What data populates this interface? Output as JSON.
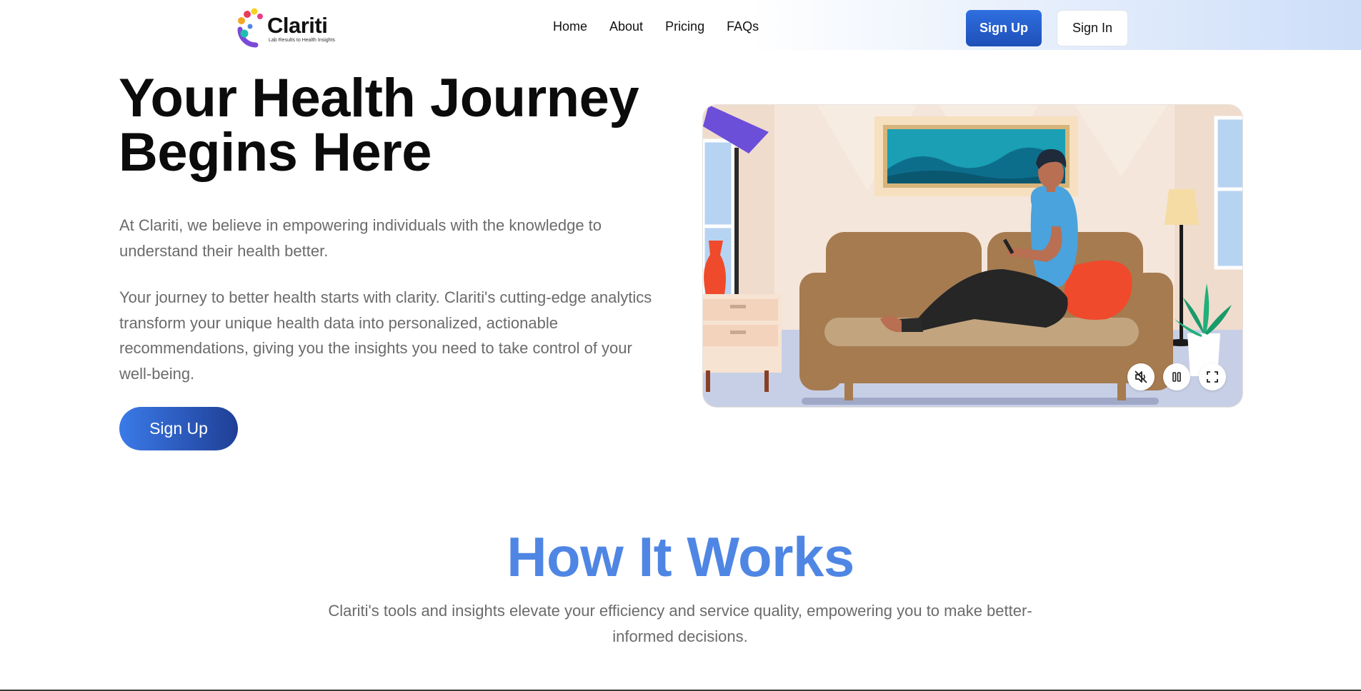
{
  "brand": {
    "name": "Clariti",
    "tagline": "Lab Results to Health Insights"
  },
  "nav": {
    "items": [
      {
        "label": "Home"
      },
      {
        "label": "About"
      },
      {
        "label": "Pricing"
      },
      {
        "label": "FAQs"
      }
    ]
  },
  "header": {
    "signup_label": "Sign Up",
    "signin_label": "Sign In"
  },
  "hero": {
    "title_line1": "Your Health Journey",
    "title_line2": "Begins Here",
    "paragraph1": "At Clariti, we believe in empowering individuals with the knowledge to understand their health better.",
    "paragraph2": "Your journey to better health starts with clarity. Clariti's cutting-edge analytics transform your unique health data into personalized, actionable recommendations, giving you the insights you need to take control of your well-being.",
    "cta_label": "Sign Up"
  },
  "video": {
    "controls": [
      {
        "name": "mute",
        "icon": "volume-muted-icon"
      },
      {
        "name": "pause",
        "icon": "pause-icon"
      },
      {
        "name": "fullscreen",
        "icon": "fullscreen-icon"
      }
    ]
  },
  "how_it_works": {
    "title": "How It Works",
    "subtitle": "Clariti's tools and insights elevate your efficiency and service quality, empowering you to make better-informed decisions."
  },
  "colors": {
    "primary": "#2f6fe0",
    "primary_dark": "#1f3f96",
    "heading_blue": "#4f86e4",
    "body_text": "#6b6b6b"
  }
}
